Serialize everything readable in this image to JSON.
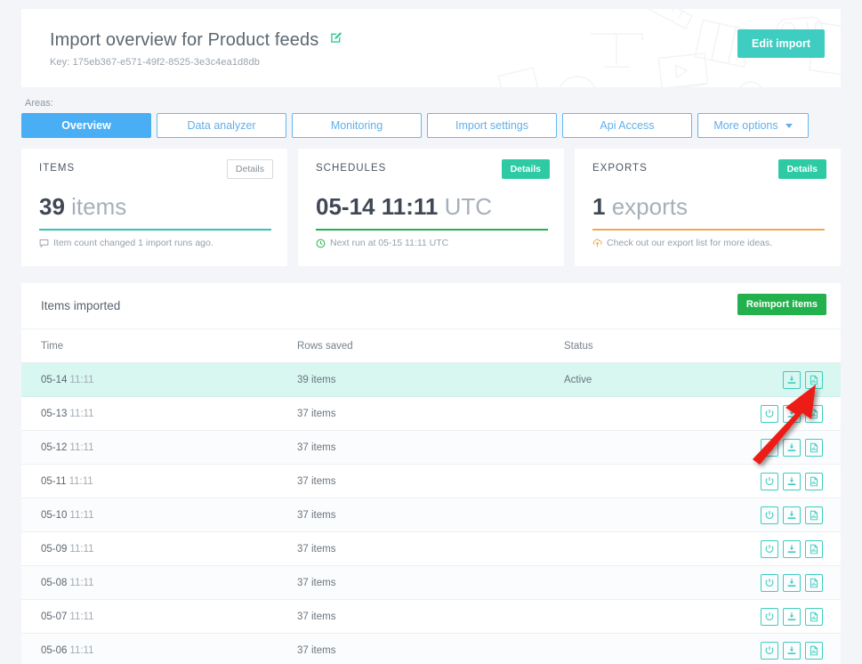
{
  "header": {
    "title": "Import overview for Product feeds",
    "edit_title_icon": "pencil-square-icon",
    "key_label": "Key: 175eb367-e571-49f2-8525-3e3c4ea1d8db",
    "edit_import_label": "Edit import",
    "accent_teal": "#3ecdc0"
  },
  "areas": {
    "label": "Areas:",
    "tabs": [
      {
        "label": "Overview",
        "active": true
      },
      {
        "label": "Data analyzer",
        "active": false
      },
      {
        "label": "Monitoring",
        "active": false
      },
      {
        "label": "Import settings",
        "active": false
      },
      {
        "label": "Api Access",
        "active": false
      },
      {
        "label": "More options",
        "active": false,
        "caret": true
      }
    ],
    "active_color": "#4aaef4"
  },
  "cards": [
    {
      "label": "ITEMS",
      "details_label": "Details",
      "details_style": "ghost",
      "value_number": "39",
      "value_unit": "items",
      "rule_color": "#2ec7b0",
      "foot_icon": "comment-icon",
      "foot_icon_color": "#9aa3ad",
      "foot_text": "Item count changed 1 import runs ago."
    },
    {
      "label": "SCHEDULES",
      "details_label": "Details",
      "details_style": "solid",
      "value_number": "05-14 11:11",
      "value_unit": "UTC",
      "rule_color": "#23b24b",
      "foot_icon": "clock-icon",
      "foot_icon_color": "#23b24b",
      "foot_text": "Next run at 05-15 11:11 UTC"
    },
    {
      "label": "EXPORTS",
      "details_label": "Details",
      "details_style": "solid",
      "value_number": "1",
      "value_unit": "exports",
      "rule_color": "#f0a952",
      "foot_icon": "export-cloud-icon",
      "foot_icon_color": "#f0a952",
      "foot_text": "Check out our export list for more ideas."
    }
  ],
  "table": {
    "title": "Items imported",
    "reimport_label": "Reimport items",
    "reimport_color": "#22b14c",
    "columns": {
      "time": "Time",
      "rows": "Rows saved",
      "status": "Status"
    },
    "rows": [
      {
        "date": "05-14",
        "time": "11:11",
        "rows_saved": "39 items",
        "status": "Active",
        "highlight": true,
        "actions": [
          "download-icon",
          "report-file-icon"
        ]
      },
      {
        "date": "05-13",
        "time": "11:11",
        "rows_saved": "37 items",
        "status": "",
        "highlight": false,
        "actions": [
          "power-rerun-icon",
          "download-icon",
          "report-file-icon"
        ]
      },
      {
        "date": "05-12",
        "time": "11:11",
        "rows_saved": "37 items",
        "status": "",
        "highlight": false,
        "actions": [
          "power-rerun-icon",
          "download-icon",
          "report-file-icon"
        ]
      },
      {
        "date": "05-11",
        "time": "11:11",
        "rows_saved": "37 items",
        "status": "",
        "highlight": false,
        "actions": [
          "power-rerun-icon",
          "download-icon",
          "report-file-icon"
        ]
      },
      {
        "date": "05-10",
        "time": "11:11",
        "rows_saved": "37 items",
        "status": "",
        "highlight": false,
        "actions": [
          "power-rerun-icon",
          "download-icon",
          "report-file-icon"
        ]
      },
      {
        "date": "05-09",
        "time": "11:11",
        "rows_saved": "37 items",
        "status": "",
        "highlight": false,
        "actions": [
          "power-rerun-icon",
          "download-icon",
          "report-file-icon"
        ]
      },
      {
        "date": "05-08",
        "time": "11:11",
        "rows_saved": "37 items",
        "status": "",
        "highlight": false,
        "actions": [
          "power-rerun-icon",
          "download-icon",
          "report-file-icon"
        ]
      },
      {
        "date": "05-07",
        "time": "11:11",
        "rows_saved": "37 items",
        "status": "",
        "highlight": false,
        "actions": [
          "power-rerun-icon",
          "download-icon",
          "report-file-icon"
        ]
      },
      {
        "date": "05-06",
        "time": "11:11",
        "rows_saved": "37 items",
        "status": "",
        "highlight": false,
        "actions": [
          "power-rerun-icon",
          "download-icon",
          "report-file-icon"
        ]
      }
    ]
  },
  "annotation": {
    "type": "arrow",
    "color": "#ee1c13",
    "points_to": "report-file-icon of first row"
  }
}
